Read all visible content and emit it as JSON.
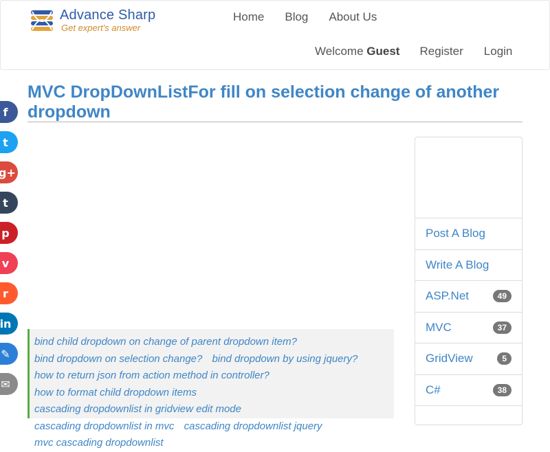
{
  "brand": {
    "name": "Advance Sharp",
    "tagline": "Get expert's answer"
  },
  "nav": {
    "home": "Home",
    "blog": "Blog",
    "about": "About Us",
    "welcome_prefix": "Welcome",
    "user": "Guest",
    "register": "Register",
    "login": "Login"
  },
  "title": "MVC DropDownListFor fill on selection change of another dropdown",
  "social": [
    {
      "name": "facebook",
      "glyph": "f"
    },
    {
      "name": "twitter",
      "glyph": "t"
    },
    {
      "name": "google-plus",
      "glyph": "g+"
    },
    {
      "name": "tumblr",
      "glyph": "t"
    },
    {
      "name": "pinterest",
      "glyph": "p"
    },
    {
      "name": "pocket",
      "glyph": "v"
    },
    {
      "name": "reddit",
      "glyph": "r"
    },
    {
      "name": "linkedin",
      "glyph": "in"
    },
    {
      "name": "pin",
      "glyph": "✎"
    },
    {
      "name": "email",
      "glyph": "✉"
    }
  ],
  "tags": [
    "bind child dropdown on change of parent dropdown item?",
    "bind dropdown on selection change?",
    "bind dropdown by using jquery?",
    "how to return json from action method in controller?",
    "how to format child dropdown items",
    "cascading dropdownlist in gridview edit mode",
    "cascading dropdownlist in mvc",
    "cascading dropdownlist jquery",
    "mvc cascading dropdownlist"
  ],
  "sidebar": {
    "items": [
      {
        "label": "Post A Blog",
        "count": ""
      },
      {
        "label": "Write A Blog",
        "count": ""
      },
      {
        "label": "ASP.Net",
        "count": "49"
      },
      {
        "label": "MVC",
        "count": "37"
      },
      {
        "label": "GridView",
        "count": "5"
      },
      {
        "label": "C#",
        "count": "38"
      }
    ]
  }
}
